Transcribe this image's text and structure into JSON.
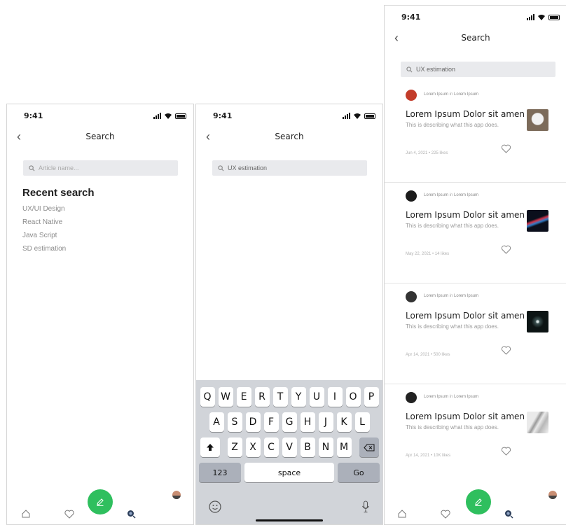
{
  "status": {
    "time": "9:41"
  },
  "screen1": {
    "title": "Search",
    "search_placeholder": "Article name...",
    "recent_heading": "Recent search",
    "recent": [
      "UX/UI Design",
      "React Native",
      "Java Script",
      "SD estimation"
    ]
  },
  "screen2": {
    "title": "Search",
    "search_value": "UX estimation",
    "keyboard": {
      "row1": [
        "Q",
        "W",
        "E",
        "R",
        "T",
        "Y",
        "U",
        "I",
        "O",
        "P"
      ],
      "row2": [
        "A",
        "S",
        "D",
        "F",
        "G",
        "H",
        "J",
        "K",
        "L"
      ],
      "row3": [
        "Z",
        "X",
        "C",
        "V",
        "B",
        "N",
        "M"
      ],
      "num_label": "123",
      "space_label": "space",
      "go_label": "Go"
    }
  },
  "screen3": {
    "title": "Search",
    "search_value": "UX estimation",
    "cards": [
      {
        "author": "Lorem Ipsum",
        "in": "in",
        "source": "Lorem Ipsum",
        "title": "Lorem Ipsum Dolor sit amen",
        "desc": "This is describing what this app does.",
        "date": "Jun 4, 2021 • 225 likes",
        "avatar_color": "#c33c2a",
        "thumb_color": "#7c6b5a"
      },
      {
        "author": "Lorem Ipsum",
        "in": "in",
        "source": "Lorem Ipsum",
        "title": "Lorem Ipsum Dolor sit amen",
        "desc": "This is describing what this app does.",
        "date": "May 22, 2021 • 14 likes",
        "avatar_color": "#1b1b1b",
        "thumb_color": "#1a1f2e"
      },
      {
        "author": "Lorem Ipsum",
        "in": "in",
        "source": "Lorem Ipsum",
        "title": "Lorem Ipsum Dolor sit amen",
        "desc": "This is describing what this app does.",
        "date": "Apr 14, 2021 • 500 likes",
        "avatar_color": "#333333",
        "thumb_color": "#0c1414"
      },
      {
        "author": "Lorem Ipsum",
        "in": "in",
        "source": "Lorem Ipsum",
        "title": "Lorem Ipsum Dolor sit amen",
        "desc": "This is describing what this app does.",
        "date": "Apr 14, 2021 • 10K likes",
        "avatar_color": "#222222",
        "thumb_color": "#c9c9c9"
      }
    ]
  },
  "colors": {
    "accent": "#2fbf5e",
    "search_bg": "#e9eaed",
    "keyboard_bg": "#d1d4d9"
  }
}
